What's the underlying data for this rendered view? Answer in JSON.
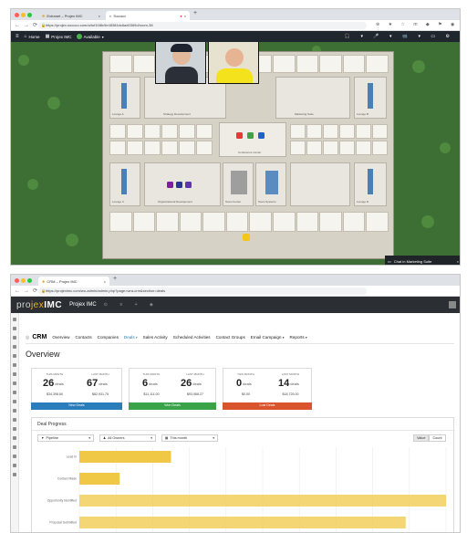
{
  "window1": {
    "tabs": [
      {
        "label": "Extranet – Projex IMC"
      },
      {
        "label": "Sococo"
      }
    ],
    "url": "https://projex.sococo.com/a/tuf1f48c9e48384dc6ad0369d/room-38",
    "sococo": {
      "home_label": "Home",
      "space_label": "Projex IMC",
      "status_label": "Available",
      "rooms": {
        "strategy": "Strategy Development",
        "marketing": "Marketing Suite",
        "lounge_a": "Lounge A",
        "lounge_b": "Lounge B",
        "lounge_c": "Lounge C",
        "lounge_d": "Lounge D",
        "conference": "Conference Center",
        "org_dev": "Organizational Development",
        "team_center": "Team Center",
        "team_sys": "Team Systems"
      },
      "office_label": "PM03",
      "chat_label": "Chat in Marketing Suite",
      "colors": {
        "map": "#3d6e34",
        "topbar": "#20262d",
        "available": "#4caf50"
      }
    }
  },
  "window2": {
    "tabs": [
      {
        "label": "CRM – Projex IMC"
      }
    ],
    "url": "https://projeximc.com/wo-admin/admin.php?page=wra-crm&section=deals",
    "brand": {
      "pro": "pro",
      "jex": "jex",
      "imc": "IMC",
      "name": "Projex IMC"
    },
    "crm_nav": {
      "title": "CRM",
      "items": [
        "Overview",
        "Contacts",
        "Companies",
        "Deals",
        "Sales Activity",
        "Scheduled Activities",
        "Contact Groups",
        "Email Campaign",
        "Reports"
      ]
    },
    "overview": {
      "title": "Overview",
      "cards": [
        {
          "this_label": "THIS MONTH",
          "this_value": "26",
          "this_unit": "deals",
          "this_money": "$34,398.60",
          "last_label": "LAST MONTH",
          "last_value": "67",
          "last_unit": "deals",
          "last_money": "$82,931.75",
          "button": "New Deals",
          "color": "#2a7dba"
        },
        {
          "this_label": "THIS MONTH",
          "this_value": "6",
          "this_unit": "deals",
          "this_money": "$11,111.00",
          "last_label": "LAST MONTH",
          "last_value": "26",
          "last_unit": "deals",
          "last_money": "$93,568.27",
          "button": "Won Deals",
          "color": "#3aa34a"
        },
        {
          "this_label": "THIS MONTH",
          "this_value": "0",
          "this_unit": "deals",
          "this_money": "$0.00",
          "last_label": "LAST MONTH",
          "last_value": "14",
          "last_unit": "deals",
          "last_money": "$18,725.00",
          "button": "Lost Deals",
          "color": "#d9532c"
        }
      ]
    },
    "deal_progress": {
      "title": "Deal Progress",
      "filters": {
        "pipeline": "Pipeline",
        "owner": "All Owners",
        "period": "This month"
      },
      "toggle": [
        "Value",
        "Count"
      ]
    },
    "chart_data": {
      "type": "bar",
      "orientation": "horizontal",
      "categories": [
        "Lead In",
        "Contact Made",
        "Opportunity Identified",
        "Proposal Submitted"
      ],
      "values": [
        25,
        11,
        100,
        89
      ],
      "xlim": [
        0,
        100
      ],
      "color": "#f0c846"
    }
  }
}
